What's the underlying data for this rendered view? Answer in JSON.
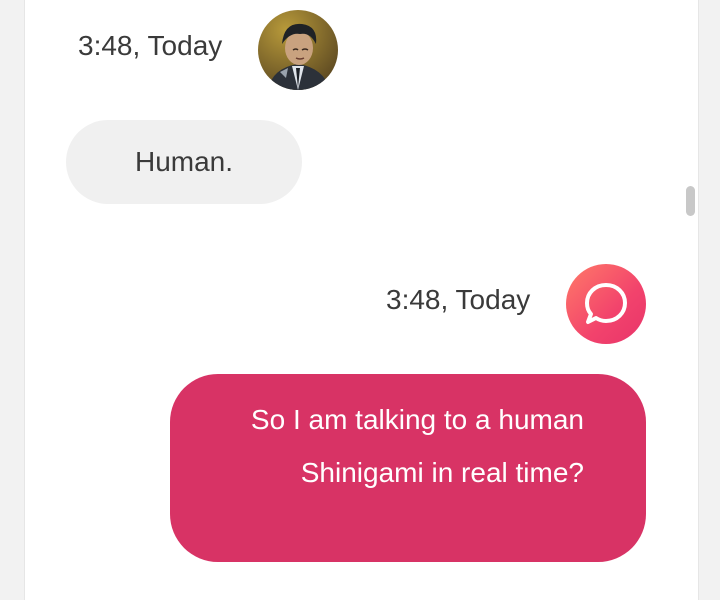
{
  "messages": [
    {
      "direction": "incoming",
      "timestamp": "3:48, Today",
      "avatar_icon": "user-avatar-icon",
      "text": "Human."
    },
    {
      "direction": "outgoing",
      "timestamp": "3:48, Today",
      "avatar_icon": "chat-bubble-icon",
      "text": "So I am talking to a human Shinigami in real time?"
    }
  ],
  "colors": {
    "incoming_bubble": "#f0f0f0",
    "outgoing_bubble": "#d83365",
    "brand_gradient_start": "#ff7a68",
    "brand_gradient_end": "#e8346a"
  }
}
